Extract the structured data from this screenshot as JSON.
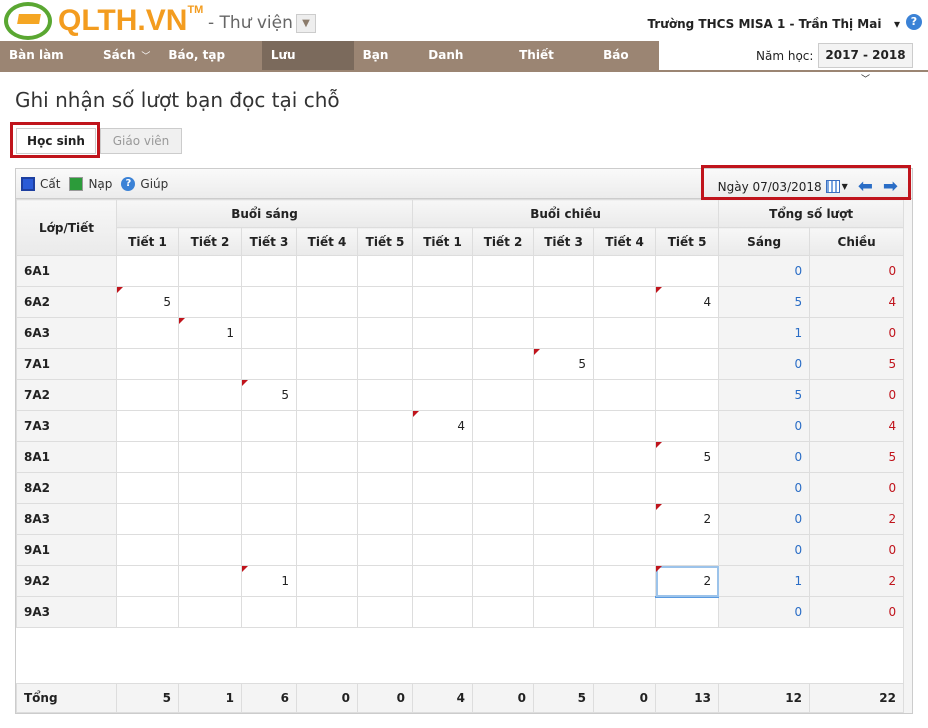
{
  "header": {
    "logo": "QLTH.VN",
    "tm": "TM",
    "app": "- Thư viện",
    "user": "Trường THCS MISA 1 - Trần Thị Mai",
    "year_label": "Năm học:",
    "year": "2017 - 2018"
  },
  "nav": [
    {
      "label": "Bàn làm việc",
      "chev": false
    },
    {
      "label": "Sách",
      "chev": true
    },
    {
      "label": "Báo, tạp chí",
      "chev": true
    },
    {
      "label": "Lưu thông",
      "chev": true,
      "active": true
    },
    {
      "label": "Bạn đọc",
      "chev": false
    },
    {
      "label": "Danh mục",
      "chev": true
    },
    {
      "label": "Thiết lập",
      "chev": true
    },
    {
      "label": "Báo cáo",
      "chev": false
    }
  ],
  "page_title": "Ghi nhận số lượt bạn đọc tại chỗ",
  "tabs": [
    "Học sinh",
    "Giáo viên"
  ],
  "toolbar": {
    "save": "Cất",
    "reload": "Nạp",
    "help": "Giúp",
    "date": "Ngày 07/03/2018"
  },
  "table": {
    "class_header": "Lớp/Tiết",
    "morning": "Buổi sáng",
    "afternoon": "Buổi chiều",
    "total_header": "Tổng số lượt",
    "periods": [
      "Tiết 1",
      "Tiết 2",
      "Tiết 3",
      "Tiết 4",
      "Tiết 5"
    ],
    "sum_cols": [
      "Sáng",
      "Chiều"
    ],
    "rows": [
      {
        "cls": "6A1",
        "v": [
          "",
          "",
          "",
          "",
          "",
          "",
          "",
          "",
          "",
          ""
        ],
        "s": "0",
        "c": "0"
      },
      {
        "cls": "6A2",
        "v": [
          "5",
          "",
          "",
          "",
          "",
          "",
          "",
          "",
          "",
          "4"
        ],
        "s": "5",
        "c": "4"
      },
      {
        "cls": "6A3",
        "v": [
          "",
          "1",
          "",
          "",
          "",
          "",
          "",
          "",
          "",
          ""
        ],
        "s": "1",
        "c": "0"
      },
      {
        "cls": "7A1",
        "v": [
          "",
          "",
          "",
          "",
          "",
          "",
          "",
          "5",
          "",
          ""
        ],
        "s": "0",
        "c": "5"
      },
      {
        "cls": "7A2",
        "v": [
          "",
          "",
          "5",
          "",
          "",
          "",
          "",
          "",
          "",
          ""
        ],
        "s": "5",
        "c": "0"
      },
      {
        "cls": "7A3",
        "v": [
          "",
          "",
          "",
          "",
          "",
          "4",
          "",
          "",
          "",
          ""
        ],
        "s": "0",
        "c": "4"
      },
      {
        "cls": "8A1",
        "v": [
          "",
          "",
          "",
          "",
          "",
          "",
          "",
          "",
          "",
          "5"
        ],
        "s": "0",
        "c": "5"
      },
      {
        "cls": "8A2",
        "v": [
          "",
          "",
          "",
          "",
          "",
          "",
          "",
          "",
          "",
          ""
        ],
        "s": "0",
        "c": "0"
      },
      {
        "cls": "8A3",
        "v": [
          "",
          "",
          "",
          "",
          "",
          "",
          "",
          "",
          "",
          "2"
        ],
        "s": "0",
        "c": "2"
      },
      {
        "cls": "9A1",
        "v": [
          "",
          "",
          "",
          "",
          "",
          "",
          "",
          "",
          "",
          ""
        ],
        "s": "0",
        "c": "0"
      },
      {
        "cls": "9A2",
        "v": [
          "",
          "",
          "1",
          "",
          "",
          "",
          "",
          "",
          "",
          "2"
        ],
        "s": "1",
        "c": "2"
      },
      {
        "cls": "9A3",
        "v": [
          "",
          "",
          "",
          "",
          "",
          "",
          "",
          "",
          "",
          ""
        ],
        "s": "0",
        "c": "0"
      }
    ],
    "total_label": "Tổng",
    "totals": [
      "5",
      "1",
      "6",
      "0",
      "0",
      "4",
      "0",
      "5",
      "0",
      "13",
      "12",
      "22"
    ]
  }
}
